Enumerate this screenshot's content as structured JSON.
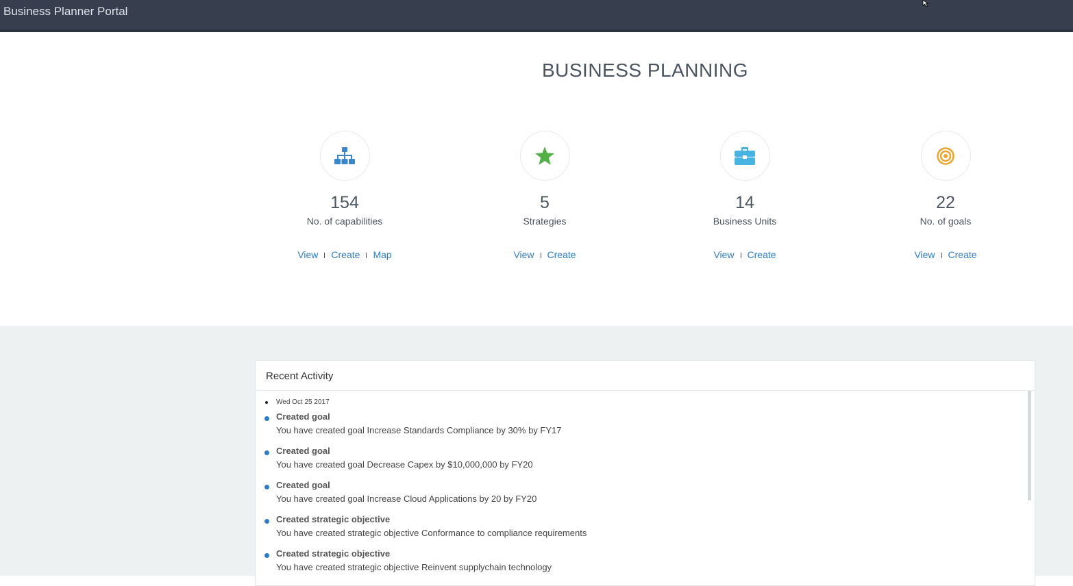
{
  "app": {
    "title": "Business Planner Portal"
  },
  "page": {
    "title": "BUSINESS PLANNING"
  },
  "stats": [
    {
      "count": "154",
      "label": "No. of capabilities",
      "icon": "sitemap-icon",
      "color": "#3a86c8",
      "links": [
        "View",
        "Create",
        "Map"
      ]
    },
    {
      "count": "5",
      "label": "Strategies",
      "icon": "star-icon",
      "color": "#52b047",
      "links": [
        "View",
        "Create"
      ]
    },
    {
      "count": "14",
      "label": "Business Units",
      "icon": "briefcase-icon",
      "color": "#47b3e0",
      "links": [
        "View",
        "Create"
      ]
    },
    {
      "count": "22",
      "label": "No. of goals",
      "icon": "target-icon",
      "color": "#f0a32c",
      "links": [
        "View",
        "Create"
      ]
    }
  ],
  "activity": {
    "title": "Recent Activity",
    "date": "Wed Oct 25 2017",
    "items": [
      {
        "title": "Created goal",
        "desc": "You have created goal Increase Standards Compliance by 30% by FY17"
      },
      {
        "title": "Created goal",
        "desc": "You have created goal Decrease Capex by $10,000,000 by FY20"
      },
      {
        "title": "Created goal",
        "desc": "You have created goal Increase Cloud Applications by 20 by FY20"
      },
      {
        "title": "Created strategic objective",
        "desc": "You have created strategic objective Conformance to compliance requirements"
      },
      {
        "title": "Created strategic objective",
        "desc": "You have created strategic objective Reinvent supplychain technology"
      }
    ]
  }
}
